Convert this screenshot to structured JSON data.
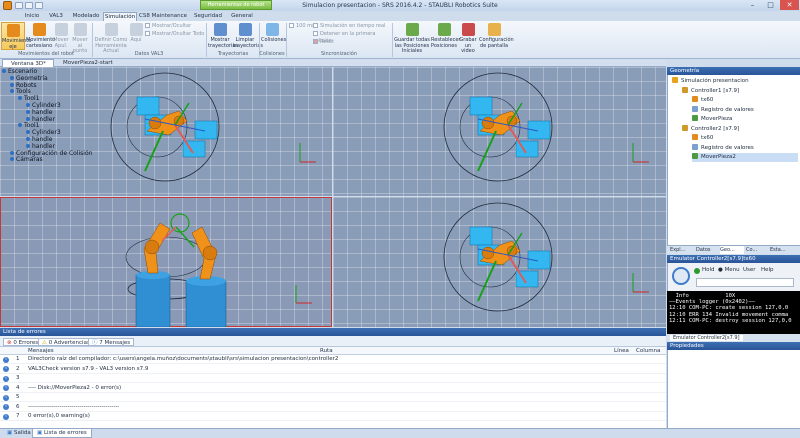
{
  "window": {
    "title": "Simulacion presentacion - SRS 2016.4.2 - STAUBLI Robotics Suite",
    "context_tab": "Herramientas de robot",
    "controls": {
      "minimize": "–",
      "maximize": "□",
      "close": "✕"
    }
  },
  "ribbon_tabs": [
    "Inicio",
    "VAL3",
    "Modelado",
    "Simulación",
    "CS8 Maintenance",
    "Seguridad",
    "General"
  ],
  "active_tab": "Simulación",
  "ribbon": {
    "groups": {
      "movimientos": "Movimientos del robot",
      "datos_val3": "Datos VAL3",
      "trayectorias": "Trayectorias",
      "colisiones": "Colisiones",
      "sincronizacion": "Sincronización"
    },
    "buttons": {
      "mov_eje": "Movimiento eje",
      "mov_cart": "Movimiento cartesiano",
      "mover_apul": "Mover Apul.",
      "mover_punto": "Mover al punto",
      "definir_como": "Definir Como Herramienta Actual",
      "aqui": "Aquí",
      "mostrar_ocultar": "Mostrar/Ocultar",
      "mostrar_ocultar_todo": "Mostrar/Ocultar Todo",
      "mostrar_tray": "Mostrar trayectorias",
      "limpiar_tray": "Limpiar trayectorias",
      "colisiones": "Colisiones",
      "ms_value": "100 ms",
      "sim_tiempo_real": "Simulación en tiempo real",
      "detener_colision": "Detener en la primera colisión",
      "reset": "Reset",
      "guardar_pos": "Guardar todas las Posiciones Iniciales",
      "restablecer_pos": "Restablecer Posiciones",
      "grabar_video": "Grabar un video",
      "config_pantalla": "Configuración de pantalla"
    }
  },
  "doc_tabs": [
    "Ventana 3D*",
    "MoverPieza2-start"
  ],
  "scene_tree": [
    {
      "label": "Escenario",
      "indent": 0
    },
    {
      "label": "Geometría",
      "indent": 1
    },
    {
      "label": "Robots",
      "indent": 1
    },
    {
      "label": "Tools",
      "indent": 1
    },
    {
      "label": "Tool1",
      "indent": 2
    },
    {
      "label": "Cylinder3",
      "indent": 3
    },
    {
      "label": "handle",
      "indent": 3
    },
    {
      "label": "handler",
      "indent": 3
    },
    {
      "label": "Tool1",
      "indent": 2
    },
    {
      "label": "Cylinder3",
      "indent": 3
    },
    {
      "label": "handle",
      "indent": 3
    },
    {
      "label": "handler",
      "indent": 3
    },
    {
      "label": "Configuración de Colisión",
      "indent": 1
    },
    {
      "label": "Cámaras",
      "indent": 1
    }
  ],
  "geometry_panel": {
    "title": "Geometría",
    "items": [
      {
        "label": "Simulación presentacion",
        "indent": 0,
        "color": "#e6a31b",
        "selected": false
      },
      {
        "label": "Controller1 [s7.9]",
        "indent": 1,
        "color": "#d09a2a",
        "selected": false
      },
      {
        "label": "tx60",
        "indent": 2,
        "color": "#e58b1e",
        "selected": false
      },
      {
        "label": "Registro de valores",
        "indent": 2,
        "color": "#7aa0cf",
        "selected": false
      },
      {
        "label": "MoverPieza",
        "indent": 2,
        "color": "#4e9a43",
        "selected": false
      },
      {
        "label": "Controller2 [s7.9]",
        "indent": 1,
        "color": "#d09a2a",
        "selected": false
      },
      {
        "label": "tx60",
        "indent": 2,
        "color": "#e58b1e",
        "selected": false
      },
      {
        "label": "Registro de valores",
        "indent": 2,
        "color": "#7aa0cf",
        "selected": false
      },
      {
        "label": "MoverPieza2",
        "indent": 2,
        "color": "#4e9a43",
        "selected": true
      }
    ]
  },
  "panel_tabs": [
    "Expl...",
    "Datos",
    "Geo...",
    "Co...",
    "Esta..."
  ],
  "emulator": {
    "title": "Emulator Controller2[s7.9]tx60",
    "hold": "Hold",
    "menu": "Menu",
    "user": "User",
    "help": "Help",
    "screen_lines": [
      "  Info           10X",
      "——Events logger (0x2402)——",
      "12:10 COM-PC: create session 127,0,0",
      "12:10 ERR 134 Invalid movement comma",
      "12:11 COM-PC: destroy session 127,0,0"
    ],
    "bottom_tab": "Emulator Controller2[s7.9]"
  },
  "properties_title": "Propiedades",
  "error_list": {
    "title": "Lista de errores",
    "filters": [
      "0 Errores",
      "0 Advertencias",
      "7 Mensajes"
    ],
    "columns": [
      "Mensajes",
      "Ruta",
      "Línea",
      "Columna"
    ],
    "rows": [
      {
        "num": "1",
        "msg": "Directorio raíz del compilador: c:\\users\\angela.muñoz\\documents\\staubli\\srs\\simulacion presentacion\\controller2"
      },
      {
        "num": "2",
        "msg": "VAL3Check version s7.9 - VAL3 version s7.9"
      },
      {
        "num": "3",
        "msg": ""
      },
      {
        "num": "4",
        "msg": "---- Disk://MoverPieza2 - 0 error(s)"
      },
      {
        "num": "5",
        "msg": ""
      },
      {
        "num": "6",
        "msg": "----------------------------------------------"
      },
      {
        "num": "7",
        "msg": "0 error(s),0 warning(s)"
      }
    ]
  },
  "status_tabs": [
    "Salida",
    "Lista de errores"
  ],
  "colors": {
    "accent": "#2a5598",
    "robot": "#f0921a",
    "workpiece": "#33b7f0",
    "viewport_bg": "#8a9db8",
    "axis_x": "#d02525",
    "axis_y": "#18a018"
  }
}
